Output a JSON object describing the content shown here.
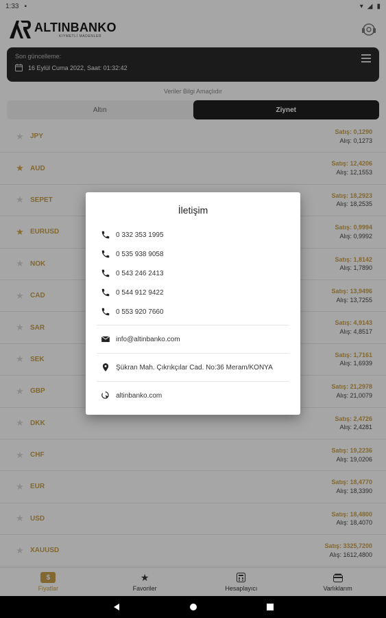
{
  "status": {
    "time": "1:33",
    "signal": "▾",
    "battery": "▮"
  },
  "header": {
    "brand_name": "ALTINBANKO",
    "brand_tagline": "KIYMETLİ MADENLER"
  },
  "update": {
    "label": "Son güncelleme:",
    "datetime": "16 Eylül Cuma 2022, Saat: 01:32:42"
  },
  "info_note": "Veriler Bilgi Amaçlıdır",
  "tabs": [
    {
      "label": "Altın",
      "active": false
    },
    {
      "label": "Ziynet",
      "active": true
    }
  ],
  "rows": [
    {
      "code": "JPY",
      "fav": false,
      "sell": "Satış: 0,1290",
      "buy": "Alış: 0,1273"
    },
    {
      "code": "AUD",
      "fav": true,
      "sell": "Satış: 12,4206",
      "buy": "Alış: 12,1553"
    },
    {
      "code": "SEPET",
      "fav": false,
      "sell": "Satış: 18,2923",
      "buy": "Alış: 18,2535"
    },
    {
      "code": "EURUSD",
      "fav": true,
      "sell": "Satış: 0,9994",
      "buy": "Alış: 0,9992"
    },
    {
      "code": "NOK",
      "fav": false,
      "sell": "Satış: 1,8142",
      "buy": "Alış: 1,7890"
    },
    {
      "code": "CAD",
      "fav": false,
      "sell": "Satış: 13,9496",
      "buy": "Alış: 13,7255"
    },
    {
      "code": "SAR",
      "fav": false,
      "sell": "Satış: 4,9143",
      "buy": "Alış: 4,8517"
    },
    {
      "code": "SEK",
      "fav": false,
      "sell": "Satış: 1,7161",
      "buy": "Alış: 1,6939"
    },
    {
      "code": "GBP",
      "fav": false,
      "sell": "Satış: 21,2978",
      "buy": "Alış: 21,0079"
    },
    {
      "code": "DKK",
      "fav": false,
      "sell": "Satış: 2,4726",
      "buy": "Alış: 2,4281"
    },
    {
      "code": "CHF",
      "fav": false,
      "sell": "Satış: 19,2236",
      "buy": "Alış: 19,0206"
    },
    {
      "code": "EUR",
      "fav": false,
      "sell": "Satış: 18,4770",
      "buy": "Alış: 18,3390"
    },
    {
      "code": "USD",
      "fav": false,
      "sell": "Satış: 18,4800",
      "buy": "Alış: 18,4070"
    },
    {
      "code": "XAUUSD",
      "fav": false,
      "sell": "Satış: 3325,7200",
      "buy": "Alış: 1612,4800"
    }
  ],
  "bottom_nav": [
    {
      "label": "Fiyatlar",
      "icon": "dollar-icon",
      "active": true
    },
    {
      "label": "Favoriler",
      "icon": "star-icon",
      "active": false
    },
    {
      "label": "Hesaplayıcı",
      "icon": "calculator-icon",
      "active": false
    },
    {
      "label": "Varlıklarım",
      "icon": "wallet-icon",
      "active": false
    }
  ],
  "dialog": {
    "title": "İletişim",
    "phones": [
      "0 332 353 1995",
      "0 535 938 9058",
      "0 543 246 2413",
      "0 544 912 9422",
      "0 553 920 7660"
    ],
    "email": "info@altinbanko.com",
    "address": "Şükran Mah. Çıkrıkçılar Cad. No:36 Meram/KONYA",
    "website": "altinbanko.com"
  },
  "colors": {
    "accent": "#c8a04a",
    "dark": "#1f1f1f"
  }
}
